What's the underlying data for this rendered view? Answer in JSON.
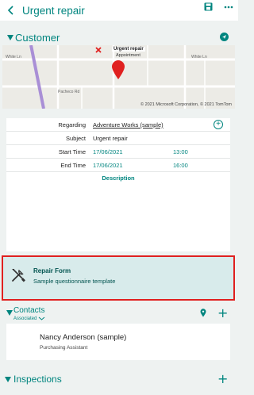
{
  "header": {
    "title": "Urgent repair"
  },
  "customer_section": {
    "title": "Customer"
  },
  "map": {
    "pin_title": "Urgent repair",
    "pin_subtitle": "Appointment",
    "credit": "© 2021 Microsoft Corporation, © 2021 TomTom"
  },
  "details": {
    "regarding_label": "Regarding",
    "regarding_value": "Adventure Works (sample)",
    "subject_label": "Subject",
    "subject_value": "Urgent repair",
    "start_label": "Start Time",
    "start_date": "17/06/2021",
    "start_time": "13:00",
    "end_label": "End Time",
    "end_date": "17/06/2021",
    "end_time": "16:00",
    "description_label": "Description"
  },
  "repair_form": {
    "title": "Repair Form",
    "subtitle": "Sample questionnaire template"
  },
  "contacts": {
    "title": "Contacts",
    "filter": "Associated",
    "items": [
      {
        "name": "Nancy Anderson (sample)",
        "role": "Purchasing Assistant"
      }
    ]
  },
  "inspections": {
    "title": "Inspections"
  },
  "colors": {
    "accent": "#00857f",
    "highlight": "#e0201f",
    "card_tint": "#d8ebeb"
  }
}
